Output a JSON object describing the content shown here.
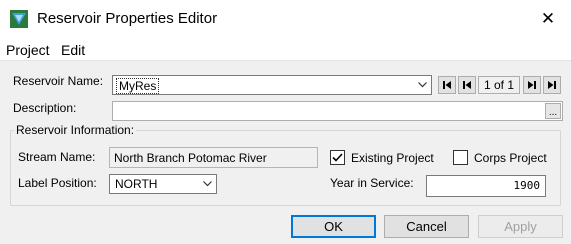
{
  "window": {
    "title": "Reservoir Properties Editor",
    "close_glyph": "✕"
  },
  "menu": {
    "items": [
      "Project",
      "Edit"
    ]
  },
  "reservoir": {
    "name_label": "Reservoir Name:",
    "name_value": "MyRes",
    "nav_counter": "1 of 1",
    "description_label": "Description:",
    "description_value": "",
    "description_button": "..."
  },
  "info": {
    "group_label": "Reservoir Information:",
    "stream_label": "Stream Name:",
    "stream_value": "North Branch Potomac River",
    "label_position_label": "Label Position:",
    "label_position_value": "NORTH",
    "existing_project_label": "Existing Project",
    "existing_project_checked": true,
    "corps_project_label": "Corps Project",
    "corps_project_checked": false,
    "year_label": "Year in Service:",
    "year_value": "1900"
  },
  "buttons": {
    "ok": "OK",
    "cancel": "Cancel",
    "apply": "Apply"
  },
  "colors": {
    "accent": "#0078d7",
    "window_bg": "#f0f0f0",
    "disabled_text": "#a0a0a0"
  }
}
